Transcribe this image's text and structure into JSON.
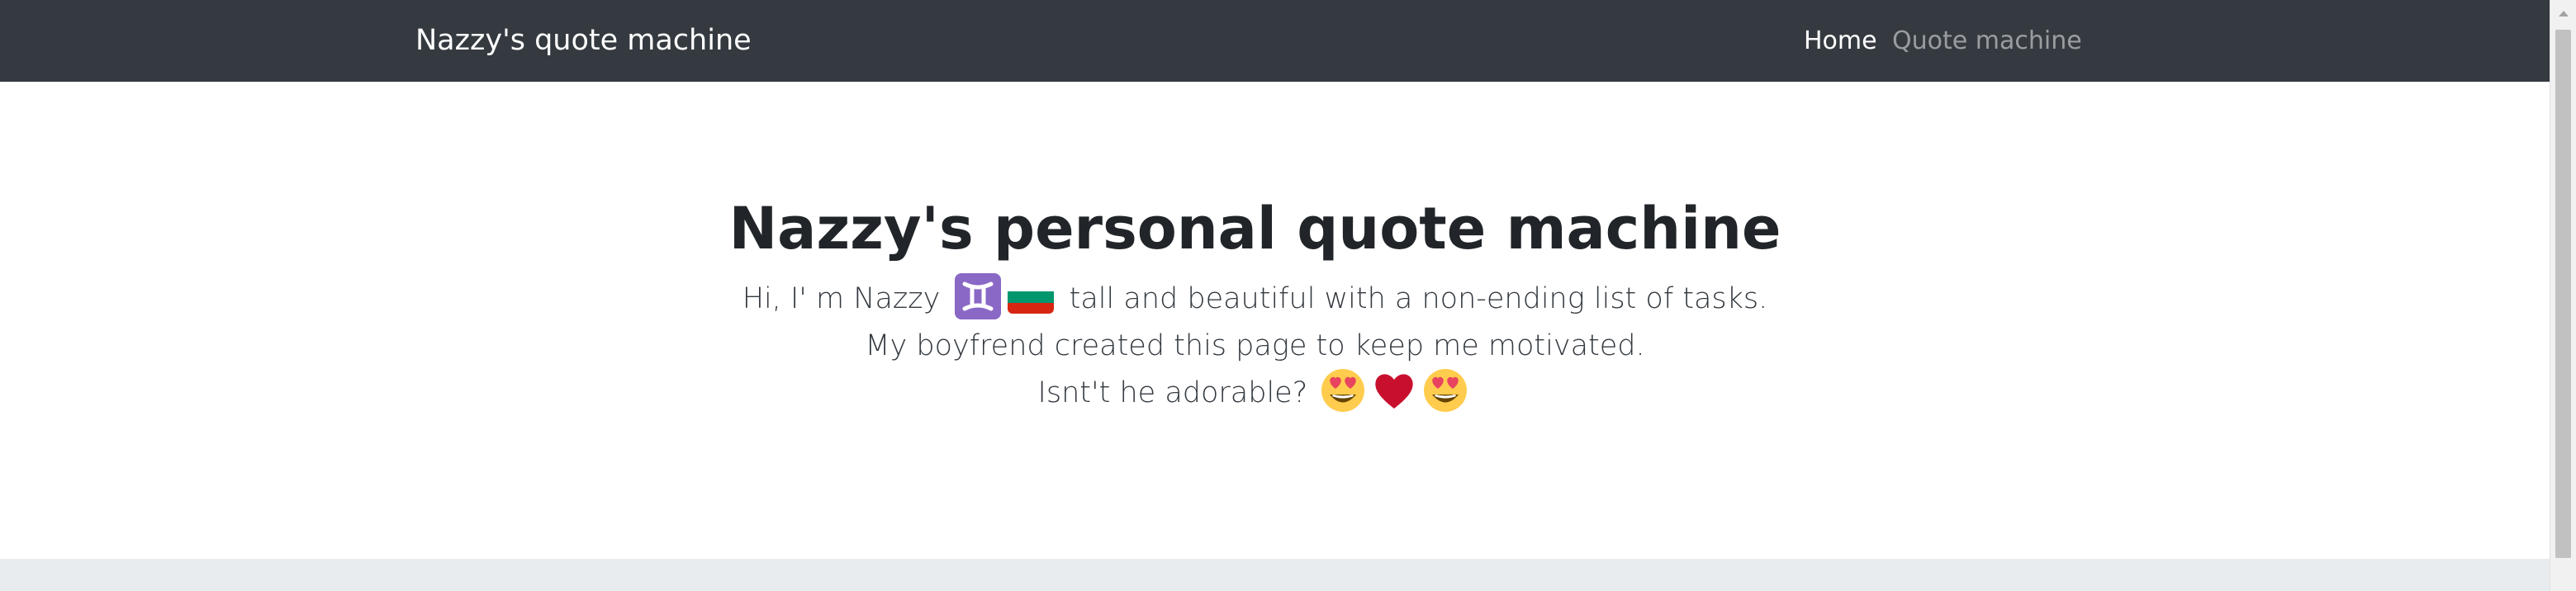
{
  "navbar": {
    "brand": "Nazzy's quote machine",
    "links": [
      {
        "label": "Home",
        "active": true
      },
      {
        "label": "Quote machine",
        "active": false
      }
    ]
  },
  "hero": {
    "title": "Nazzy's personal quote machine",
    "line1_prefix": "Hi, I' m Nazzy",
    "line1_suffix": "tall and beautiful with a non-ending list of tasks.",
    "line2": "My boyfrend created this page to keep me motivated.",
    "line3": "Isnt't he adorable?",
    "emojis_line1": [
      "gemini-icon",
      "bulgaria-flag-icon"
    ],
    "emojis_line3": [
      "heart-eyes-face-icon",
      "red-heart-icon",
      "heart-eyes-face-icon"
    ]
  },
  "colors": {
    "navbar_bg": "#343a40",
    "gemini_bg": "#8a68c6",
    "heart": "#c8102e",
    "face": "#ffcc4d",
    "eyes": "#e8445f",
    "band_bg": "#e9ecef"
  }
}
